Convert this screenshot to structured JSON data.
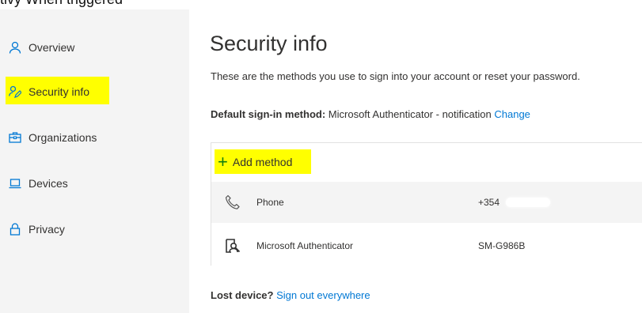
{
  "top_cut_text": "tivy When triggered",
  "sidebar": {
    "items": [
      {
        "label": "Overview",
        "icon": "person-icon"
      },
      {
        "label": "Security info",
        "icon": "security-info-icon"
      },
      {
        "label": "Organizations",
        "icon": "briefcase-icon"
      },
      {
        "label": "Devices",
        "icon": "laptop-icon"
      },
      {
        "label": "Privacy",
        "icon": "lock-icon"
      }
    ],
    "selected": "Security info"
  },
  "main": {
    "title": "Security info",
    "description": "These are the methods you use to sign into your account or reset your password.",
    "default_method": {
      "label": "Default sign-in method:",
      "value": "Microsoft Authenticator - notification",
      "change_link": "Change"
    },
    "add_method": "Add method",
    "methods": [
      {
        "name": "Phone",
        "value": "+354",
        "icon": "phone-icon"
      },
      {
        "name": "Microsoft Authenticator",
        "value": "SM-G986B",
        "icon": "authenticator-icon"
      }
    ],
    "lost_device": {
      "label": "Lost device?",
      "link": "Sign out everywhere"
    }
  },
  "colors": {
    "accent": "#0078d4",
    "highlight": "#ffff00",
    "add_plus": "#107c10",
    "sidebar_bg": "#f4f4f4"
  }
}
